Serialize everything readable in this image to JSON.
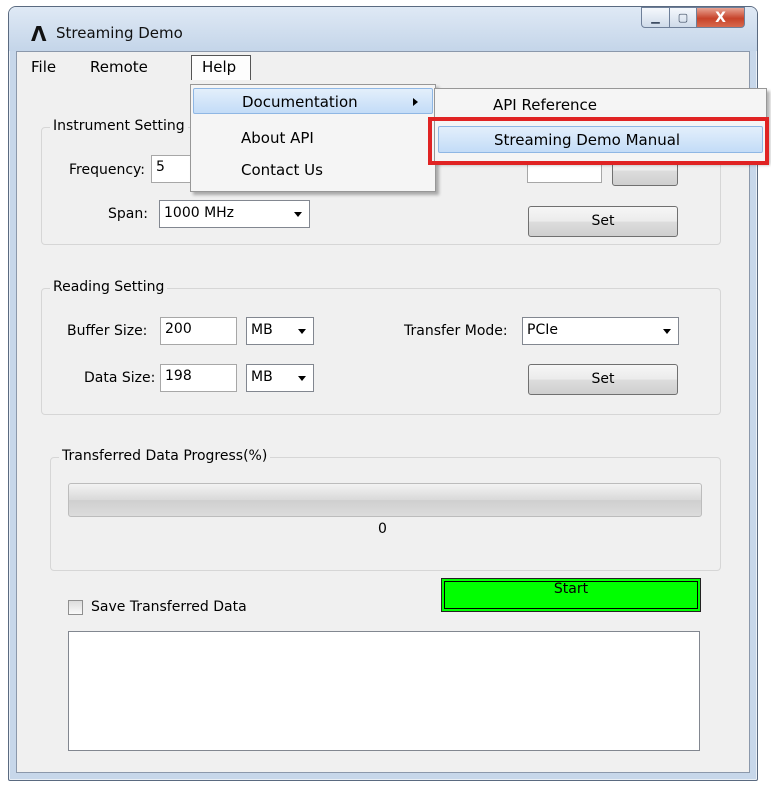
{
  "window": {
    "logo_glyph": "Λ",
    "title": "Streaming Demo",
    "minimize_glyph": "▁",
    "maximize_glyph": "▢",
    "close_glyph": "X"
  },
  "menubar": {
    "file": "File",
    "remote": "Remote",
    "help": "Help"
  },
  "help_menu": {
    "items": [
      "Documentation",
      "About API",
      "Contact Us"
    ],
    "highlighted": "Documentation"
  },
  "documentation_submenu": {
    "items": [
      "API Reference",
      "Streaming Demo Manual"
    ],
    "highlighted": "Streaming Demo Manual"
  },
  "instrument": {
    "group_label": "Instrument Setting",
    "frequency_label": "Frequency:",
    "frequency_value": "5",
    "span_label": "Span:",
    "span_value": "1000 MHz",
    "set_label": "Set"
  },
  "reading": {
    "group_label": "Reading Setting",
    "buffer_label": "Buffer Size:",
    "buffer_value": "200",
    "buffer_unit": "MB",
    "data_label": "Data Size:",
    "data_value": "198",
    "data_unit": "MB",
    "transfer_label": "Transfer Mode:",
    "transfer_value": "PCIe",
    "set_label": "Set"
  },
  "progress": {
    "group_label": "Transferred Data Progress(%)",
    "value": 0,
    "value_text": "0"
  },
  "controls": {
    "start_label": "Start",
    "start_color": "#00ff00",
    "save_label": "Save Transferred Data",
    "save_checked": false
  },
  "colors": {
    "highlight_outline": "#e02323",
    "menu_highlight": "#c3dcf7"
  }
}
